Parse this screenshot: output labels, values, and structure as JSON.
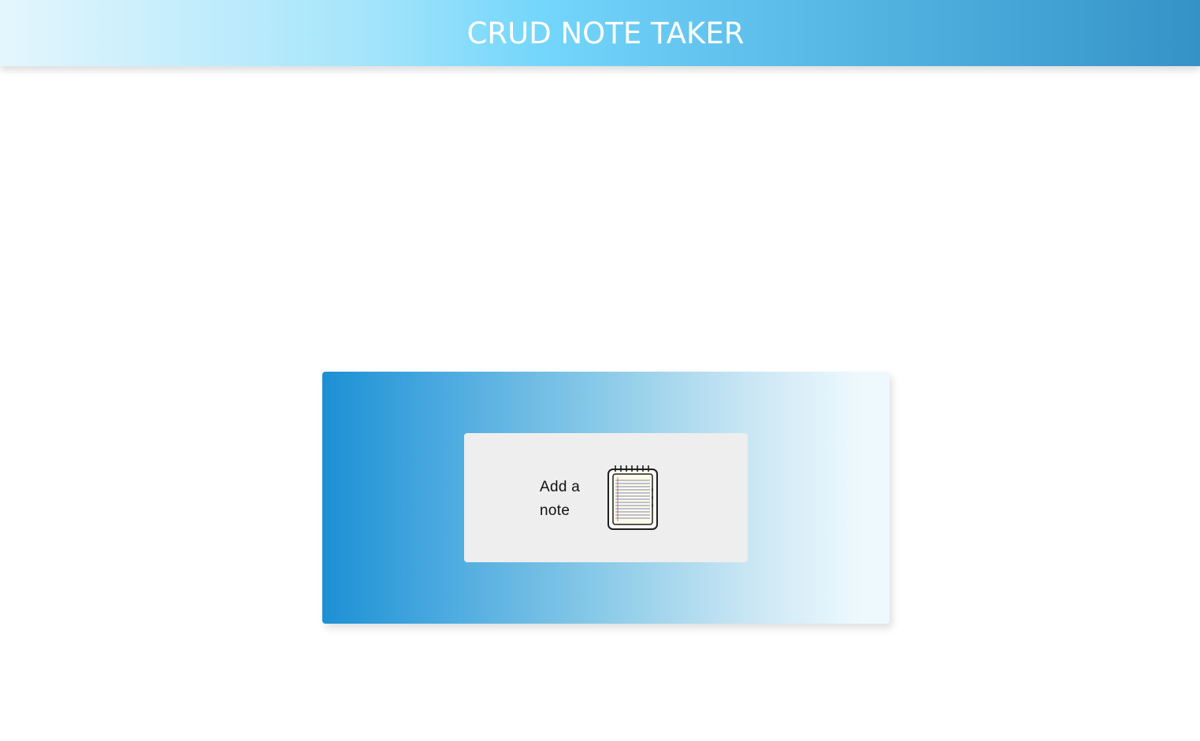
{
  "header": {
    "title": "CRUD NOTE TAKER"
  },
  "main": {
    "add_note": {
      "label": "Add a note",
      "icon": "notepad-icon"
    }
  },
  "colors": {
    "header_gradient_start": "#e4f6fd",
    "header_gradient_end": "#3592c7",
    "panel_gradient_start": "#1c90d4",
    "panel_gradient_end": "#eef9fe",
    "card_background": "#eeeeee"
  }
}
